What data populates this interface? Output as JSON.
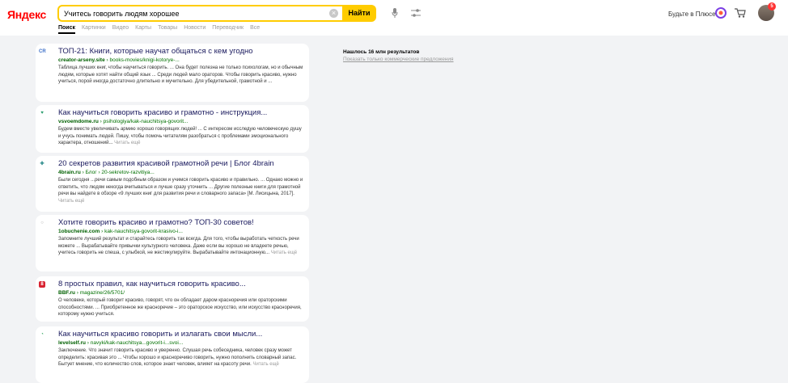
{
  "header": {
    "logo": "Яндекс",
    "search_value": "Учитесь говорить людям хорошее",
    "find_label": "Найти",
    "plus_label": "Будьте в Плюсе",
    "notification_count": "5"
  },
  "tabs": [
    "Поиск",
    "Картинки",
    "Видео",
    "Карты",
    "Товары",
    "Новости",
    "Переводчик",
    "Все"
  ],
  "sidebar": {
    "count": "Нашлось 16 млн результатов",
    "ads_link": "Показать только коммерческие предложения"
  },
  "results": [
    {
      "favicon": "CR",
      "title": "ТОП-21: Книги, которые научат общаться с кем угодно",
      "domain": "creator-arseny.site",
      "path": "› books-movies/knigi-kotorye-...",
      "desc": "Таблица лучших книг, чтобы научиться говорить. ... Она будет полезна не только психологам, но и обычным людям, которые хотят найти общий язык ... Среди людей мало ораторов. Чтобы говорить красиво, нужно учиться, порой иногда достаточно длительно и мучительно. Для убедительной, грамотной и ..."
    },
    {
      "favicon": "♥",
      "title": "Как научиться говорить красиво и грамотно - инструкция...",
      "domain": "vsvoemdome.ru",
      "path": "› psihologiya/kak-nauchitsya-govorit...",
      "desc": "Будем вместе увеличивать армию хорошо говорящих людей! ... С интересом исследую человеческую душу и учусь понимать людей. Пишу, чтобы помочь читателям разобраться с проблемами эмоционального характера, отношений..."
    },
    {
      "favicon": "✚",
      "title": "20 секретов развития красивой грамотной речи | Блог 4brain",
      "domain": "4brain.ru",
      "path": "› Блог › 20-sekretov-razvitiya...",
      "desc": "Были сегодня ...речи самым подобным образом и учимся говорить красиво и правильно. ... Однако можно и ответить, что людям некогда вчитываться и лучше сразу уточнить ... Другие полезные книги для грамотной речи вы найдете в обзоре «9 лучших книг для развития речи и словарного запаса» [М. Лисицына, 2017]."
    },
    {
      "favicon": "○",
      "title": "Хотите говорить красиво и грамотно? ТОП-30 советов!",
      "domain": "1obuchenie.com",
      "path": "› kak-nauchitsya-govorit-krasivo-i...",
      "desc": "Запомните лучший результат и старайтесь говорить так всегда. Для того, чтобы выработать четкость речи можете ... Вырабатывайте привычки культурного человека. Даже если вы хорошо не владеете речью, учитесь говорить не спеша, с улыбкой, не жестикулируйте. Вырабатывайте интонационную..."
    },
    {
      "favicon": "8",
      "title": "8 простых правил, как научиться говорить красиво...",
      "domain": "BBF.ru",
      "path": "› magazine/26/5701/",
      "desc": "О человеке, который говорит красиво, говорят, что он обладает даром красноречия или ораторскими способностями. ... Приобретенное же красноречие – это ораторское искусство, или искусство красноречия, которому нужно учиться."
    },
    {
      "favicon": "◔",
      "title": "Как научиться красиво говорить и излагать свои мысли...",
      "domain": "levelself.ru",
      "path": "› navyki/kak-nauchitsya...govorit-i...svoi...",
      "desc": "Заключение. Что значит говорить красиво и уверенно. Слушая речь собеседника, человек сразу может определить: красивая это ... Чтобы хорошо и красноречиво говорить, нужно пополнить словарный запас. Бытует мнение, что количество слов, которое знает человек, влияет на красоту речи."
    }
  ],
  "more_label": "Читать ещё"
}
